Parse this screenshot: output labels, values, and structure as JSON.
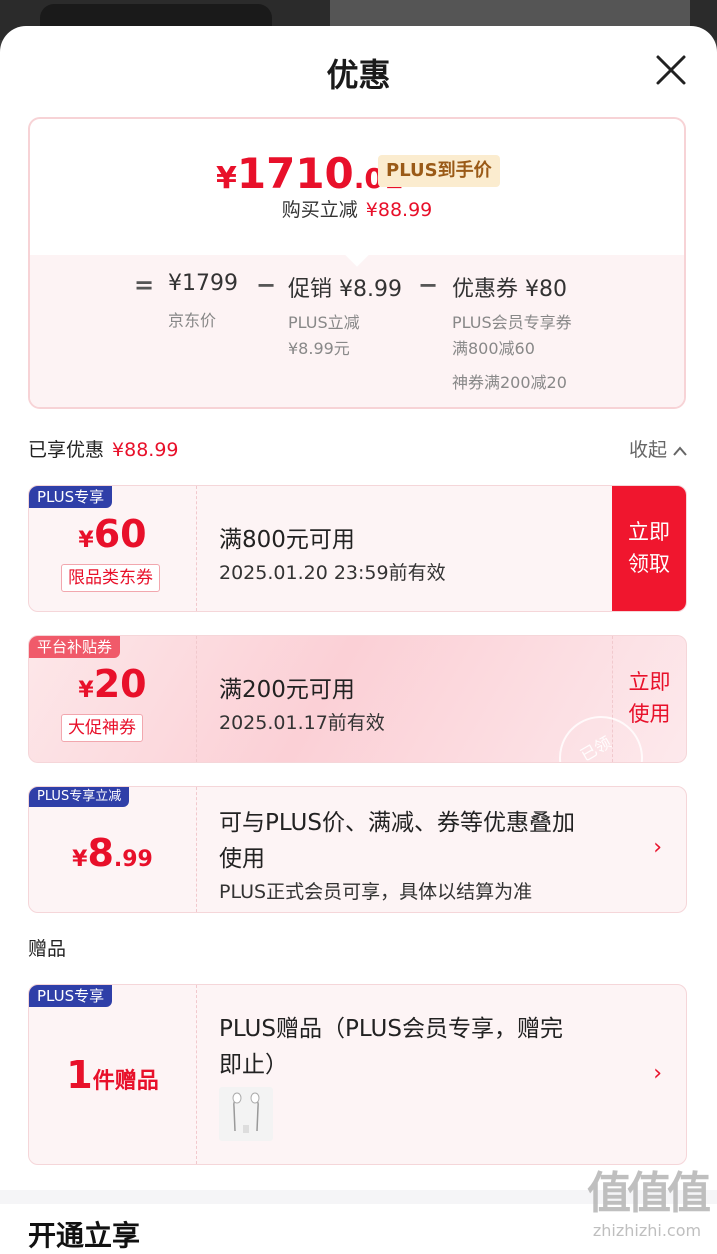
{
  "sheet": {
    "title": "优惠"
  },
  "price": {
    "symbol": "¥",
    "integer": "1710",
    "decimal": ".01",
    "tag": "PLUS到手价",
    "save_label": "购买立减",
    "save_amount": "¥88.99"
  },
  "breakdown": {
    "eq": "=",
    "minus": "−",
    "jd_price": "¥1799",
    "jd_label": "京东价",
    "promo": "促销 ¥8.99",
    "promo_sub1": "PLUS立减",
    "promo_sub2": "¥8.99元",
    "coupon": "优惠券 ¥80",
    "coupon_sub1": "PLUS会员专享券",
    "coupon_sub2": "满800减60",
    "coupon_sub3": "神券满200减20"
  },
  "enjoyed": {
    "label": "已享优惠",
    "amount": "¥88.99",
    "collapse": "收起"
  },
  "coupons": [
    {
      "tag": "PLUS专享",
      "symbol": "¥",
      "amount": "60",
      "scope": "限品类东券",
      "title": "满800元可用",
      "validity": "2025.01.20 23:59前有效",
      "action_line1": "立即",
      "action_line2": "领取"
    },
    {
      "tag": "平台补贴券",
      "symbol": "¥",
      "amount": "20",
      "scope": "大促神券",
      "title": "满200元可用",
      "validity": "2025.01.17前有效",
      "action_line1": "立即",
      "action_line2": "使用",
      "stamp": "已领"
    }
  ],
  "plus_discount": {
    "tag": "PLUS专享立减",
    "symbol": "¥",
    "int": "8",
    "dec": ".99",
    "title_line1": "可与PLUS价、满减、券等优惠叠加",
    "title_line2": "使用",
    "note": "PLUS正式会员可享，具体以结算为准"
  },
  "gift_section": {
    "label": "赠品"
  },
  "gift": {
    "tag": "PLUS专享",
    "count": "1",
    "count_label": "件赠品",
    "title_line1": "PLUS赠品（PLUS会员专享，赠完",
    "title_line2": "即止）"
  },
  "next_section": {
    "title": "开通立享"
  },
  "watermark": {
    "big": "值值值",
    "small": "zhizhizhi.com"
  },
  "colors": {
    "accent": "#e8102a",
    "plus_blue": "#2f3fa8",
    "gold": "#9a5a17"
  }
}
